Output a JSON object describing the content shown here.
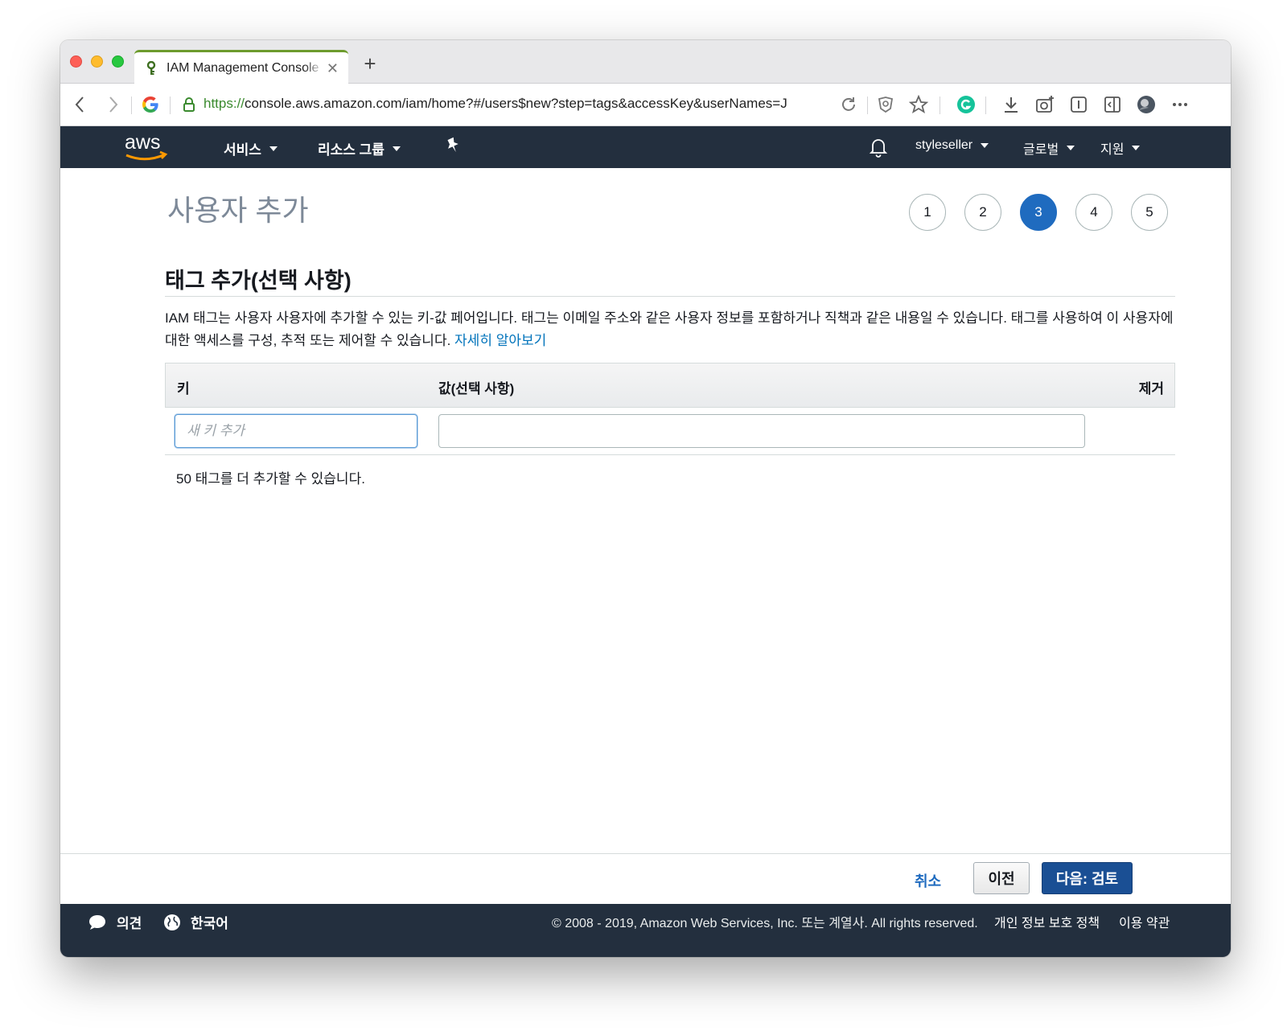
{
  "browser": {
    "tab_title": "IAM Management Console",
    "new_tab": "+",
    "tab_close": "✕",
    "url_scheme": "https://",
    "url_rest": "console.aws.amazon.com/iam/home?#/users$new?step=tags&accessKey&userNames=J"
  },
  "aws_nav": {
    "logo_text": "aws",
    "services": "서비스",
    "resource_groups": "리소스 그룹",
    "account": "styleseller",
    "region": "글로벌",
    "support": "지원"
  },
  "page": {
    "title": "사용자 추가",
    "steps": [
      "1",
      "2",
      "3",
      "4",
      "5"
    ],
    "active_step": "3",
    "section_title": "태그 추가(선택 사항)",
    "description": "IAM 태그는 사용자 사용자에 추가할 수 있는 키-값 페어입니다. 태그는 이메일 주소와 같은 사용자 정보를 포함하거나 직책과 같은 내용일 수 있습니다. 태그를 사용하여 이 사용자에 대한 액세스를 구성, 추적 또는 제어할 수 있습니다.",
    "learn_more": "자세히 알아보기",
    "table": {
      "col_key": "키",
      "col_value": "값(선택 사항)",
      "col_remove": "제거",
      "key_placeholder": "새 키 추가",
      "key_value": "",
      "value_value": ""
    },
    "remaining_text": "50 태그를 더 추가할 수 있습니다."
  },
  "actions": {
    "cancel": "취소",
    "previous": "이전",
    "next": "다음: 검토"
  },
  "footer": {
    "feedback": "의견",
    "language": "한국어",
    "copyright": "© 2008 - 2019, Amazon Web Services, Inc. 또는 계열사. All rights reserved.",
    "privacy": "개인 정보 보호 정책",
    "terms": "이용 약관"
  },
  "colors": {
    "aws_nav_bg": "#232f3e",
    "active_step": "#1f6bbf",
    "primary_button": "#1a4f94",
    "link": "#0073bb",
    "aws_orange": "#ff9900"
  }
}
